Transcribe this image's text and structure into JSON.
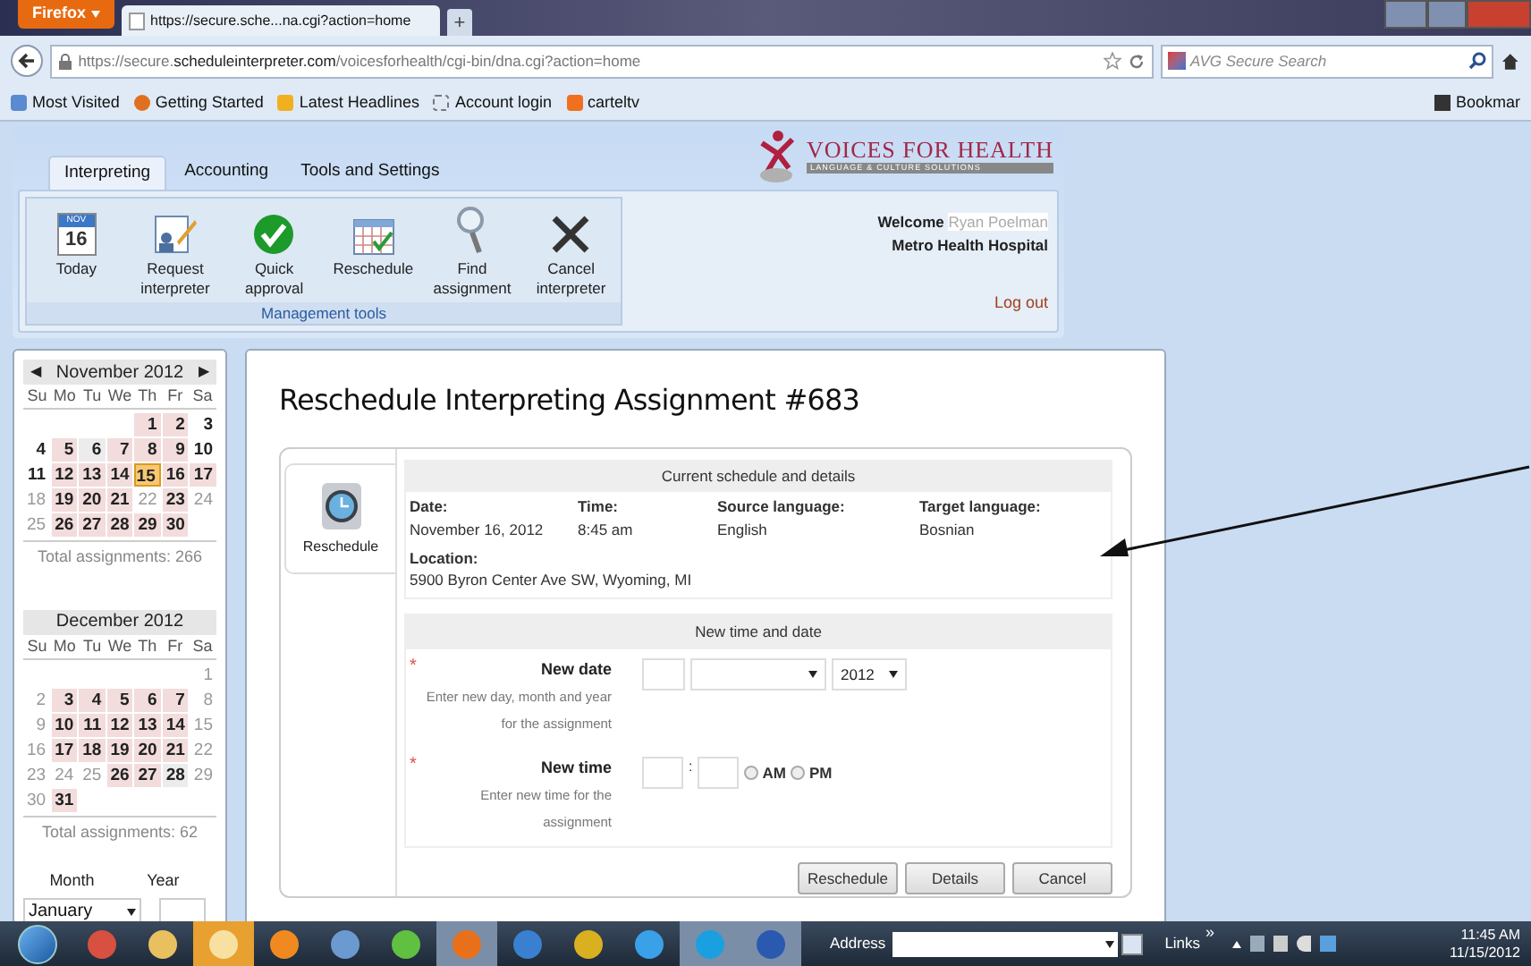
{
  "browser": {
    "menu_button": "Firefox",
    "tab_title": "https://secure.sche...na.cgi?action=home",
    "new_tab": "+",
    "url": "https://secure.**scheduleinterpreter.com**/voicesforhealth/cgi-bin/dna.cgi?action=home",
    "search_placeholder": "AVG Secure Search",
    "bookmarks": [
      "Most Visited",
      "Getting Started",
      "Latest Headlines",
      "Account login",
      "carteltv"
    ],
    "bookmarks_menu": "Bookmar"
  },
  "header": {
    "tabs": [
      {
        "label": "Interpreting",
        "selected": true
      },
      {
        "label": "Accounting",
        "selected": false
      },
      {
        "label": "Tools and Settings",
        "selected": false
      }
    ],
    "tools": [
      {
        "kind": "calendar",
        "label": "Today",
        "badge_month": "NOV",
        "badge_day": "16"
      },
      {
        "kind": "form",
        "label": "Request interpreter"
      },
      {
        "kind": "check",
        "label": "Quick approval"
      },
      {
        "kind": "grid",
        "label": "Reschedule"
      },
      {
        "kind": "magnifier",
        "label": "Find assignment"
      },
      {
        "kind": "cross",
        "label": "Cancel interpreter"
      }
    ],
    "tools_group": "Management tools",
    "logo": {
      "name": "VOICES FOR HEALTH",
      "tagline": "LANGUAGE & CULTURE SOLUTIONS"
    },
    "welcome": {
      "greeting": "Welcome",
      "user": "Ryan Poelman",
      "organization": "Metro Health Hospital",
      "logout": "Log out"
    }
  },
  "calendars": [
    {
      "month": "November 2012",
      "prev": "◀",
      "next": "▶",
      "weekdays": [
        "Su",
        "Mo",
        "Tu",
        "We",
        "Th",
        "Fr",
        "Sa"
      ],
      "total": "Total assignments: 266",
      "weeks": [
        [
          {
            "kind": "blank"
          },
          {
            "kind": "blank"
          },
          {
            "kind": "blank"
          },
          {
            "kind": "blank"
          },
          {
            "day": "1",
            "kind": "booked"
          },
          {
            "day": "2",
            "kind": "booked"
          },
          {
            "day": "3",
            "kind": "plain"
          }
        ],
        [
          {
            "day": "4",
            "kind": "plain"
          },
          {
            "day": "5",
            "kind": "booked"
          },
          {
            "day": "6",
            "kind": "open"
          },
          {
            "day": "7",
            "kind": "booked"
          },
          {
            "day": "8",
            "kind": "booked"
          },
          {
            "day": "9",
            "kind": "booked"
          },
          {
            "day": "10",
            "kind": "plain"
          }
        ],
        [
          {
            "day": "11",
            "kind": "plain"
          },
          {
            "day": "12",
            "kind": "booked"
          },
          {
            "day": "13",
            "kind": "booked"
          },
          {
            "day": "14",
            "kind": "booked"
          },
          {
            "day": "15",
            "kind": "today"
          },
          {
            "day": "16",
            "kind": "booked"
          },
          {
            "day": "17",
            "kind": "booked"
          }
        ],
        [
          {
            "day": "18",
            "kind": "muted"
          },
          {
            "day": "19",
            "kind": "booked"
          },
          {
            "day": "20",
            "kind": "booked"
          },
          {
            "day": "21",
            "kind": "booked"
          },
          {
            "day": "22",
            "kind": "muted"
          },
          {
            "day": "23",
            "kind": "booked"
          },
          {
            "day": "24",
            "kind": "muted"
          }
        ],
        [
          {
            "day": "25",
            "kind": "muted"
          },
          {
            "day": "26",
            "kind": "booked"
          },
          {
            "day": "27",
            "kind": "booked"
          },
          {
            "day": "28",
            "kind": "booked"
          },
          {
            "day": "29",
            "kind": "booked"
          },
          {
            "day": "30",
            "kind": "booked"
          },
          {
            "kind": "blank"
          }
        ]
      ]
    },
    {
      "month": "December 2012",
      "weekdays": [
        "Su",
        "Mo",
        "Tu",
        "We",
        "Th",
        "Fr",
        "Sa"
      ],
      "total": "Total assignments: 62",
      "weeks": [
        [
          {
            "kind": "blank"
          },
          {
            "kind": "blank"
          },
          {
            "kind": "blank"
          },
          {
            "kind": "blank"
          },
          {
            "kind": "blank"
          },
          {
            "kind": "blank"
          },
          {
            "day": "1",
            "kind": "muted"
          }
        ],
        [
          {
            "day": "2",
            "kind": "muted"
          },
          {
            "day": "3",
            "kind": "booked"
          },
          {
            "day": "4",
            "kind": "booked"
          },
          {
            "day": "5",
            "kind": "booked"
          },
          {
            "day": "6",
            "kind": "booked"
          },
          {
            "day": "7",
            "kind": "booked"
          },
          {
            "day": "8",
            "kind": "muted"
          }
        ],
        [
          {
            "day": "9",
            "kind": "muted"
          },
          {
            "day": "10",
            "kind": "booked"
          },
          {
            "day": "11",
            "kind": "booked"
          },
          {
            "day": "12",
            "kind": "booked"
          },
          {
            "day": "13",
            "kind": "booked"
          },
          {
            "day": "14",
            "kind": "booked"
          },
          {
            "day": "15",
            "kind": "muted"
          }
        ],
        [
          {
            "day": "16",
            "kind": "muted"
          },
          {
            "day": "17",
            "kind": "booked"
          },
          {
            "day": "18",
            "kind": "booked"
          },
          {
            "day": "19",
            "kind": "booked"
          },
          {
            "day": "20",
            "kind": "booked"
          },
          {
            "day": "21",
            "kind": "booked"
          },
          {
            "day": "22",
            "kind": "muted"
          }
        ],
        [
          {
            "day": "23",
            "kind": "muted"
          },
          {
            "day": "24",
            "kind": "muted"
          },
          {
            "day": "25",
            "kind": "muted"
          },
          {
            "day": "26",
            "kind": "booked"
          },
          {
            "day": "27",
            "kind": "booked"
          },
          {
            "day": "28",
            "kind": "open"
          },
          {
            "day": "29",
            "kind": "muted"
          }
        ],
        [
          {
            "day": "30",
            "kind": "muted"
          },
          {
            "day": "31",
            "kind": "booked"
          },
          {
            "kind": "blank"
          },
          {
            "kind": "blank"
          },
          {
            "kind": "blank"
          },
          {
            "kind": "blank"
          },
          {
            "kind": "blank"
          }
        ]
      ]
    }
  ],
  "jump": {
    "month_label": "Month",
    "year_label": "Year",
    "month_value": "January"
  },
  "assignment": {
    "title": "Reschedule Interpreting Assignment #683",
    "side_tab": "Reschedule",
    "current": {
      "heading": "Current schedule and details",
      "fields": [
        {
          "label": "Date:",
          "value": "November 16, 2012"
        },
        {
          "label": "Time:",
          "value": "8:45 am"
        },
        {
          "label": "Source language:",
          "value": "English"
        },
        {
          "label": "Target language:",
          "value": "Bosnian"
        }
      ],
      "location": {
        "label": "Location:",
        "value": "5900 Byron Center Ave SW, Wyoming, MI"
      }
    },
    "new": {
      "heading": "New time and date",
      "required_mark": "*",
      "date": {
        "label": "New date",
        "hint": "Enter new day, month and year for the assignment",
        "year_value": "2012"
      },
      "time": {
        "label": "New time",
        "hint": "Enter new time for the assignment",
        "separator": ":",
        "options": [
          {
            "label": "AM",
            "selected": false
          },
          {
            "label": "PM",
            "selected": false
          }
        ]
      }
    },
    "buttons": [
      "Reschedule",
      "Details",
      "Cancel"
    ]
  },
  "taskbar": {
    "address_label": "Address",
    "links": "Links",
    "chevron": "»",
    "time": "11:45 AM",
    "date": "11/15/2012"
  }
}
